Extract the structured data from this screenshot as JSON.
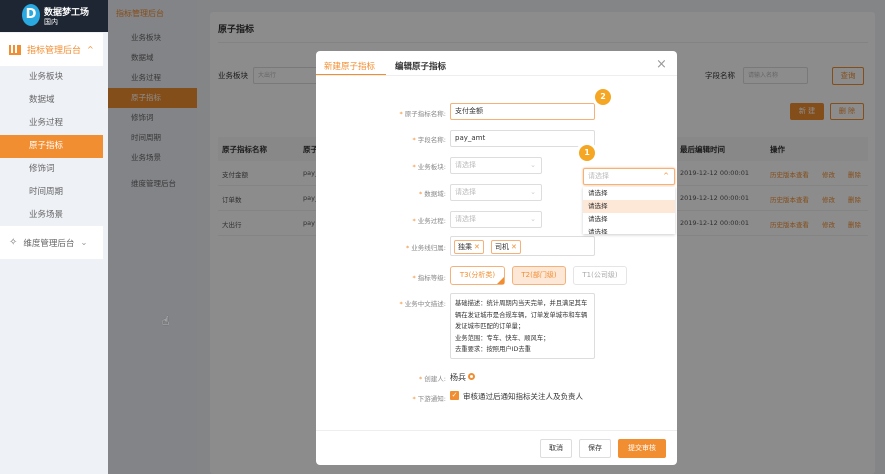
{
  "brand": {
    "name": "数据梦工场",
    "region": "国内",
    "logo_letter": "D"
  },
  "sidebar": {
    "group1": "指标管理后台",
    "items": [
      "业务板块",
      "数据域",
      "业务过程",
      "原子指标",
      "修饰词",
      "时间周期",
      "业务场景"
    ],
    "active": 3,
    "group2": "维度管理后台"
  },
  "page": {
    "title": "原子指标",
    "filters": {
      "biz_label": "业务板块",
      "biz_value": "大出行",
      "field_label": "字段名称",
      "field_placeholder": "请输入名称",
      "query": "查询"
    },
    "actions": {
      "new": "新 建",
      "delete": "删 除"
    },
    "table": {
      "headers": [
        "原子指标名称",
        "原子",
        "最后编辑时间",
        "操作"
      ],
      "rows": [
        {
          "name": "支付金额",
          "code": "pay_",
          "time": "2019-12-12 00:00:01"
        },
        {
          "name": "订单数",
          "code": "pay_",
          "time": "2019-12-12 00:00:01"
        },
        {
          "name": "大出行",
          "code": "pay",
          "time": "2019-12-12 00:00:01"
        }
      ],
      "ops": [
        "历史版本查看",
        "修改",
        "删除"
      ]
    }
  },
  "dialog": {
    "tabs": [
      "新建原子指标",
      "编辑原子指标"
    ],
    "active_tab": 0,
    "fields": {
      "name_label": "原子指标名称:",
      "name_value": "支付金额",
      "field_label": "字段名称:",
      "field_value": "pay_amt",
      "biz_label": "业务板块:",
      "domain_label": "数据域:",
      "process_label": "业务过程:",
      "placeholder": "请选择",
      "line_label": "业务线归属:",
      "line_tags": [
        "独乘",
        "司机"
      ],
      "level_label": "指标等级:",
      "levels": [
        "T3(分析类)",
        "T2(部门级)",
        "T1(公司级)"
      ],
      "level_selected": 0,
      "desc_label": "业务中文描述:",
      "desc_lines": [
        "基础描述：统计周期内当天完单，并且满足其车",
        "辆在发证城市是合规车辆，订单发单城市和车辆",
        "发证城市匹配的订单量；",
        "业务范围：专车、快车、顺风车；",
        "去重要求：按照用户ID去重"
      ],
      "creator_label": "创建人:",
      "creator": "杨兵",
      "notify_label": "下游通知:",
      "notify_text": "审核通过后通知指标关注人及负责人",
      "notify_checked": true
    },
    "dropdown": {
      "placeholder": "请选择",
      "options": [
        "请选择",
        "请选择",
        "请选择",
        "请选择"
      ],
      "highlighted": 1
    },
    "badges": [
      "1",
      "2"
    ],
    "footer": {
      "cancel": "取消",
      "save": "保存",
      "submit": "提交审核"
    }
  },
  "colors": {
    "accent": "#f18e31",
    "header": "#1f2633"
  }
}
